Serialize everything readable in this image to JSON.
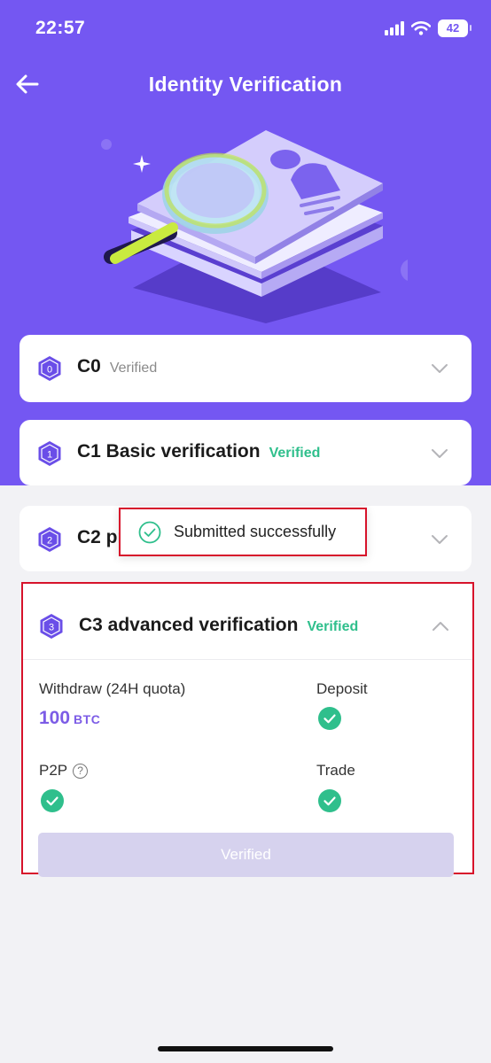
{
  "status_bar": {
    "time": "22:57",
    "battery": "42"
  },
  "header": {
    "title": "Identity Verification"
  },
  "levels": [
    {
      "badge": "0",
      "name": "C0",
      "status": "Verified"
    },
    {
      "badge": "1",
      "name": "C1 Basic verification",
      "status": "Verified"
    },
    {
      "badge": "2",
      "name": "C2 pr",
      "status": ""
    },
    {
      "badge": "3",
      "name": "C3 advanced verification",
      "status": "Verified"
    }
  ],
  "toast": {
    "text": "Submitted successfully"
  },
  "c3_details": {
    "withdraw_label": "Withdraw (24H quota)",
    "withdraw_amount": "100",
    "withdraw_unit": "BTC",
    "deposit_label": "Deposit",
    "p2p_label": "P2P",
    "p2p_help_glyph": "?",
    "trade_label": "Trade",
    "button_label": "Verified"
  },
  "colors": {
    "primary": "#7457f2",
    "verified_green": "#2fbf8c",
    "highlight_red": "#d7132b",
    "disabled_button": "#d6d2ee"
  }
}
